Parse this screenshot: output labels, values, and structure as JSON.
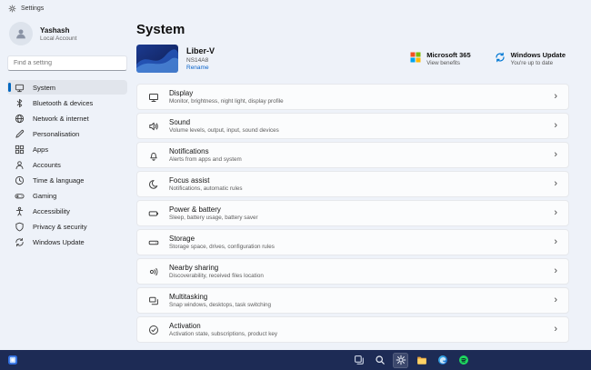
{
  "window": {
    "title": "Settings",
    "icon": "settings-gear-icon"
  },
  "sidebar": {
    "user": {
      "name": "Yashash",
      "account_type": "Local Account"
    },
    "search": {
      "placeholder": "Find a setting"
    },
    "items": [
      {
        "label": "System",
        "icon": "system-icon",
        "selected": true
      },
      {
        "label": "Bluetooth & devices",
        "icon": "bluetooth-icon",
        "selected": false
      },
      {
        "label": "Network & internet",
        "icon": "network-globe-icon",
        "selected": false
      },
      {
        "label": "Personalisation",
        "icon": "personalisation-brush-icon",
        "selected": false
      },
      {
        "label": "Apps",
        "icon": "apps-grid-icon",
        "selected": false
      },
      {
        "label": "Accounts",
        "icon": "accounts-person-icon",
        "selected": false
      },
      {
        "label": "Time & language",
        "icon": "clock-icon",
        "selected": false
      },
      {
        "label": "Gaming",
        "icon": "gamepad-icon",
        "selected": false
      },
      {
        "label": "Accessibility",
        "icon": "accessibility-icon",
        "selected": false
      },
      {
        "label": "Privacy & security",
        "icon": "shield-icon",
        "selected": false
      },
      {
        "label": "Windows Update",
        "icon": "update-arrows-icon",
        "selected": false
      }
    ]
  },
  "main": {
    "title": "System",
    "device": {
      "name": "Liber-V",
      "model": "NS14A8",
      "rename_label": "Rename"
    },
    "status_cards": [
      {
        "title": "Microsoft 365",
        "subtitle": "View benefits",
        "icon": "microsoft-365-icon"
      },
      {
        "title": "Windows Update",
        "subtitle": "You're up to date",
        "icon": "windows-update-icon"
      }
    ],
    "chevron": "›",
    "cards": [
      {
        "title": "Display",
        "subtitle": "Monitor, brightness, night light, display profile",
        "icon": "display-icon"
      },
      {
        "title": "Sound",
        "subtitle": "Volume levels, output, input, sound devices",
        "icon": "sound-icon"
      },
      {
        "title": "Notifications",
        "subtitle": "Alerts from apps and system",
        "icon": "notifications-bell-icon"
      },
      {
        "title": "Focus assist",
        "subtitle": "Notifications, automatic rules",
        "icon": "focus-moon-icon"
      },
      {
        "title": "Power & battery",
        "subtitle": "Sleep, battery usage, battery saver",
        "icon": "battery-icon"
      },
      {
        "title": "Storage",
        "subtitle": "Storage space, drives, configuration rules",
        "icon": "storage-drive-icon"
      },
      {
        "title": "Nearby sharing",
        "subtitle": "Discoverability, received files location",
        "icon": "nearby-sharing-icon"
      },
      {
        "title": "Multitasking",
        "subtitle": "Snap windows, desktops, task switching",
        "icon": "multitasking-icon"
      },
      {
        "title": "Activation",
        "subtitle": "Activation state, subscriptions, product key",
        "icon": "activation-check-icon"
      }
    ]
  },
  "taskbar": {
    "icons": [
      "widgets-icon",
      "task-view-icon",
      "search-icon",
      "settings-icon",
      "file-explorer-icon",
      "edge-icon",
      "spotify-icon"
    ],
    "active_icon": "settings-icon"
  },
  "colors": {
    "accent": "#0067c0",
    "link": "#0a63c9",
    "page_bg": "#eef2f9",
    "card_bg": "#fbfcfd",
    "card_border": "#e6e8ec",
    "taskbar_bg": "#1d2b55",
    "microsoft_red": "#f25022",
    "microsoft_green": "#7fba00",
    "microsoft_blue": "#00a4ef",
    "microsoft_yellow": "#ffb900"
  }
}
